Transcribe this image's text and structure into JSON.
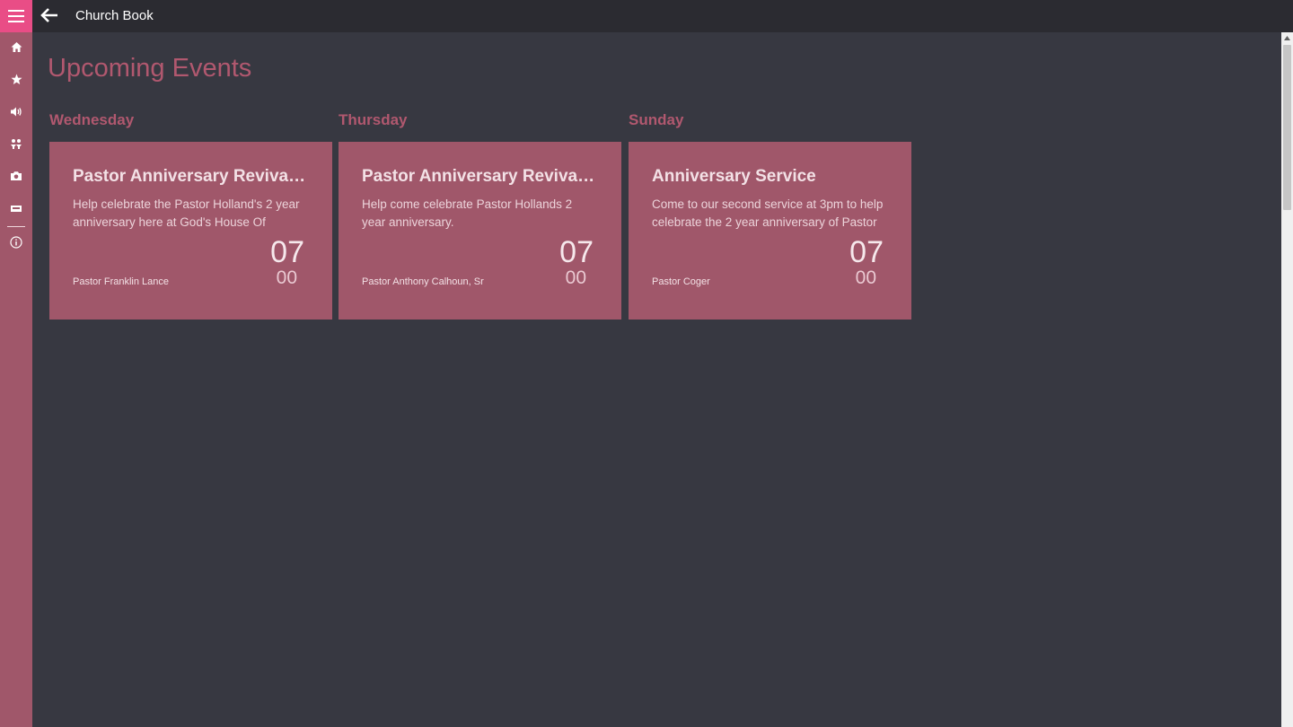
{
  "app": {
    "title": "Church Book"
  },
  "nav": {
    "items": [
      {
        "icon": "home-icon"
      },
      {
        "icon": "star-icon"
      },
      {
        "icon": "speaker-icon"
      },
      {
        "icon": "people-icon"
      },
      {
        "icon": "camera-icon"
      },
      {
        "icon": "ticket-icon"
      },
      {
        "icon": "info-icon"
      }
    ]
  },
  "page": {
    "title": "Upcoming Events"
  },
  "colors": {
    "accent": "#b1586f",
    "card": "#a0576a",
    "hamburger": "#e94d86",
    "background": "#373841",
    "titlebar": "#2b2b31"
  },
  "groups": [
    {
      "day": "Wednesday",
      "event": {
        "title": "Pastor Anniversary Revival Service",
        "description": "Help celebrate the Pastor Holland's 2 year anniversary here at God's House Of",
        "hour": "07",
        "minute": "00",
        "speaker": "Pastor Franklin Lance"
      }
    },
    {
      "day": "Thursday",
      "event": {
        "title": "Pastor Anniversary Revival Service",
        "description": "Help come celebrate Pastor Hollands 2 year anniversary.",
        "hour": "07",
        "minute": "00",
        "speaker": "Pastor Anthony Calhoun, Sr"
      }
    },
    {
      "day": "Sunday",
      "event": {
        "title": "Anniversary Service",
        "description": "Come to our second service at 3pm to help celebrate the 2 year anniversary of Pastor",
        "hour": "07",
        "minute": "00",
        "speaker": "Pastor Coger"
      }
    }
  ]
}
